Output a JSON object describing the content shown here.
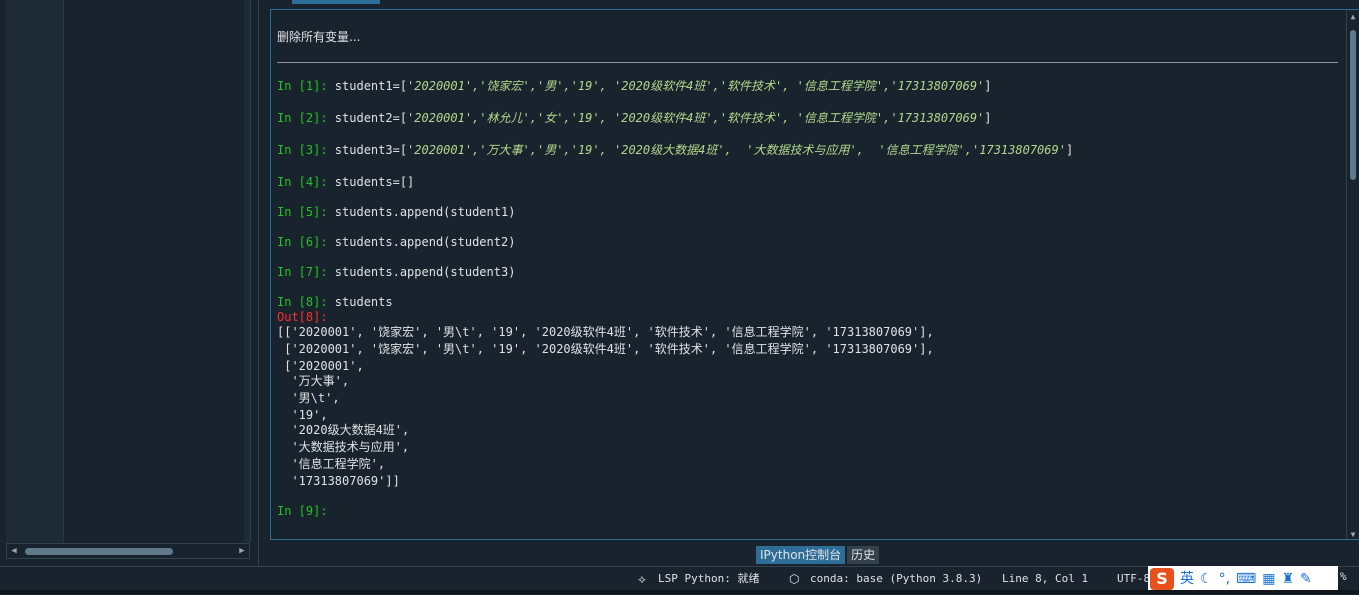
{
  "console": {
    "clear_message": "删除所有变量...",
    "lines": [
      {
        "prompt": "In [1]: ",
        "code_pre": "student1=[",
        "code_str": "'2020001','饶家宏','男','19', '2020级软件4班','软件技术', '信息工程学院','17313807069'",
        "code_post": "]"
      },
      {
        "prompt": "In [2]: ",
        "code_pre": "student2=[",
        "code_str": "'2020001','林允儿','女','19', '2020级软件4班','软件技术', '信息工程学院','17313807069'",
        "code_post": "]"
      },
      {
        "prompt": "In [3]: ",
        "code_pre": "student3=[",
        "code_str": "'2020001','万大事','男','19', '2020级大数据4班',  '大数据技术与应用',  '信息工程学院','17313807069'",
        "code_post": "]"
      },
      {
        "prompt": "In [4]: ",
        "code_pre": "students=[]",
        "code_str": "",
        "code_post": ""
      },
      {
        "prompt": "In [5]: ",
        "code_pre": "students.append(student1)",
        "code_str": "",
        "code_post": ""
      },
      {
        "prompt": "In [6]: ",
        "code_pre": "students.append(student2)",
        "code_str": "",
        "code_post": ""
      },
      {
        "prompt": "In [7]: ",
        "code_pre": "students.append(student3)",
        "code_str": "",
        "code_post": ""
      },
      {
        "prompt": "In [8]: ",
        "code_pre": "students",
        "code_str": "",
        "code_post": ""
      }
    ],
    "out_prompt": "Out[8]:",
    "output_lines": [
      "[['2020001', '饶家宏', '男\\t', '19', '2020级软件4班', '软件技术', '信息工程学院', '17313807069'],",
      " ['2020001', '饶家宏', '男\\t', '19', '2020级软件4班', '软件技术', '信息工程学院', '17313807069'],",
      " ['2020001',",
      "  '万大事',",
      "  '男\\t',",
      "  '19',",
      "  '2020级大数据4班',",
      "  '大数据技术与应用',",
      "  '信息工程学院',",
      "  '17313807069']]"
    ],
    "next_prompt": "In [9]:"
  },
  "bottom_tabs": {
    "ipython": "IPython控制台",
    "history": "历史"
  },
  "status": {
    "lsp": "LSP Python: 就绪",
    "conda": "conda: base (Python 3.8.3)",
    "position": "Line 8, Col 1",
    "encoding": "UTF-8",
    "percent": "%"
  },
  "ime": {
    "logo": "S",
    "mode": "英"
  },
  "colors": {
    "background": "#19232d",
    "prompt": "#24c324",
    "out_prompt": "#ff2d2d",
    "string": "#b1d88b",
    "accent": "#2d6e98"
  }
}
